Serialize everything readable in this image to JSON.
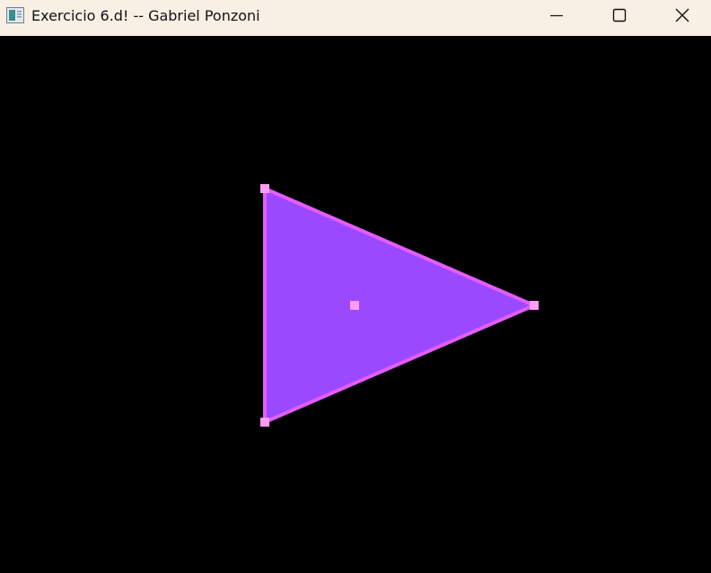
{
  "window": {
    "title": "Exercicio 6.d! -- Gabriel Ponzoni",
    "app_icon": "window-app-icon",
    "controls": [
      "minimize-icon",
      "maximize-icon",
      "close-icon"
    ]
  },
  "canvas": {
    "background": "#000000",
    "triangle": {
      "fill": "#9b49ff",
      "stroke": "#e45cff",
      "vertex_color": "#ff9cf8",
      "centroid_color": "#ff9cf8"
    }
  }
}
